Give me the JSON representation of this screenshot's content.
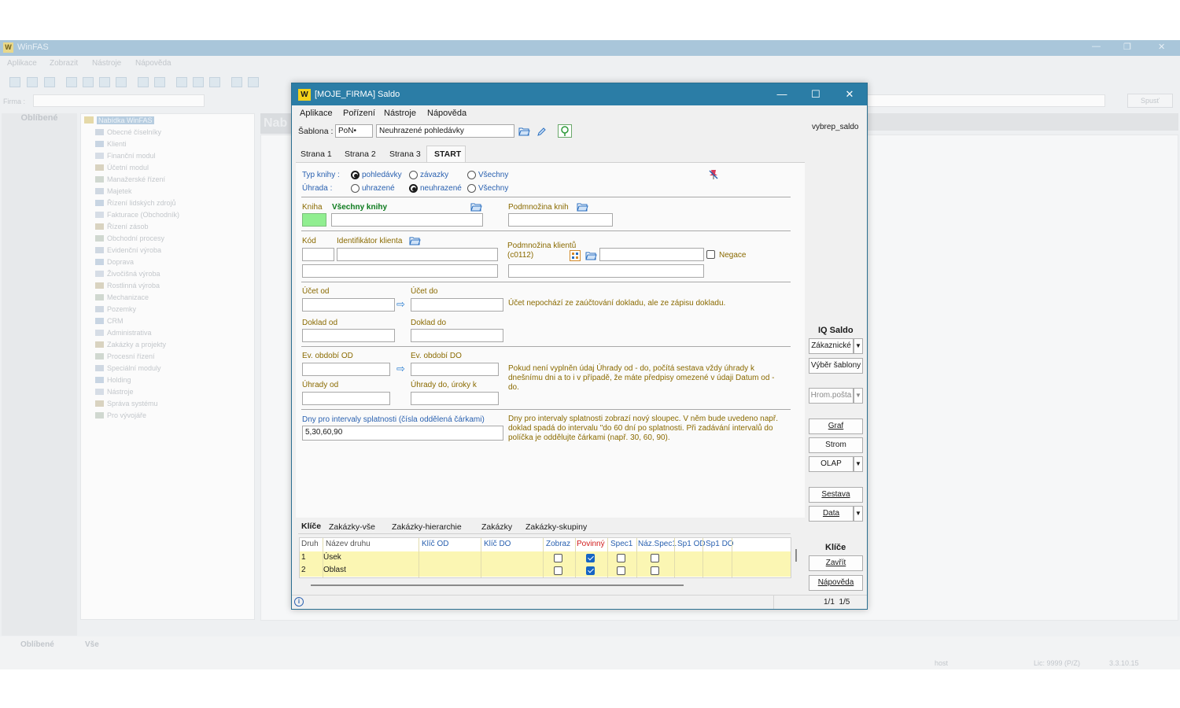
{
  "background": {
    "app_title": "WinFAS",
    "menu": [
      "Aplikace",
      "Zobrazit",
      "Nástroje",
      "Nápověda"
    ],
    "firma_label": "Firma :",
    "spust_label": "Spusť",
    "favorites_title": "Oblíbené",
    "nab_label": "Nab",
    "tree_root": "Nabídka WinFAS",
    "tree_items": [
      "Obecné číselníky",
      "Klienti",
      "Finanční modul",
      "Účetní modul",
      "Manažerské řízení",
      "Majetek",
      "Řízení lidských zdrojů",
      "Fakturace (Obchodník)",
      "Řízení zásob",
      "Obchodní procesy",
      "Evidenční výroba",
      "Doprava",
      "Živočišná výroba",
      "Rostlinná výroba",
      "Mechanizace",
      "Pozemky",
      "CRM",
      "Administrativa",
      "Zakázky a projekty",
      "Procesní řízení",
      "Speciální moduly",
      "Holding",
      "Nástroje",
      "Správa systému",
      "Pro vývojáře"
    ],
    "bottom_tabs": [
      "Oblíbené",
      "Vše"
    ],
    "status_user": "host",
    "status_lic": "Lic: 9999 (P/Z)",
    "status_version": "3.3.10.15"
  },
  "dialog": {
    "title": "[MOJE_FIRMA] Saldo",
    "menu": [
      "Aplikace",
      "Pořízení",
      "Nástroje",
      "Nápověda"
    ],
    "sablona_label": "Šablona :",
    "sablona_code": "PoN•",
    "sablona_name": "Neuhrazené pohledávky",
    "report_id": "vybrep_saldo",
    "tabs": [
      "Strana 1",
      "Strana 2",
      "Strana 3",
      "START"
    ],
    "active_tab": "START",
    "typ_knihy_label": "Typ knihy :",
    "typ_knihy_options": [
      "pohledávky",
      "závazky",
      "Všechny"
    ],
    "typ_knihy_selected": "pohledávky",
    "uhrada_label": "Úhrada :",
    "uhrada_options": [
      "uhrazené",
      "neuhrazené",
      "Všechny"
    ],
    "uhrada_selected": "neuhrazené",
    "kniha_label": "Kniha",
    "kniha_name": "Všechny knihy",
    "podmnozina_knih_label": "Podmnožina knih",
    "kod_label": "Kód",
    "identifikator_label": "Identifikátor klienta",
    "podmnozina_klientu_label": "Podmnožina klientů",
    "podmnozina_klientu_code": "(c0112)",
    "negace_label": "Negace",
    "ucet_od_label": "Účet od",
    "ucet_do_label": "Účet do",
    "ucet_note": "Účet nepochází ze zaúčtování dokladu, ale ze zápisu dokladu.",
    "doklad_od_label": "Doklad od",
    "doklad_do_label": "Doklad do",
    "ev_od_label": "Ev. období OD",
    "ev_do_label": "Ev. období DO",
    "uhrady_od_label": "Úhrady od",
    "uhrady_do_label": "Úhrady do, úroky k",
    "uhrady_note": "Pokud není vyplněn údaj Úhrady od - do, počítá sestava vždy úhrady k dnešnímu dni a to i v případě, že máte předpisy omezené v údaji Datum od - do.",
    "dny_label": "Dny pro intervaly splatnosti (čísla oddělená čárkami)",
    "dny_value": "5,30,60,90",
    "dny_note": "Dny pro intervaly splatnosti zobrazí nový sloupec. V něm bude uvedeno např. doklad spadá do intervalu \"do 60 dní po splatnosti. Při zadávání intervalů do políčka je oddělujte čárkami (např. 30, 60, 90).",
    "grid_tabs": [
      "Klíče",
      "Zakázky-vše",
      "Zakázky-hierarchie",
      "Zakázky",
      "Zakázky-skupiny"
    ],
    "grid_active_tab": "Klíče",
    "grid_columns": [
      "Druh",
      "Název druhu",
      "Klíč OD",
      "Klíč DO",
      "Zobraz",
      "Povinný",
      "Spec1",
      "Náz.Spec1",
      "Sp1 OD",
      "Sp1 DO"
    ],
    "grid_rows": [
      {
        "druh": "1",
        "nazev": "Úsek",
        "zobraz": false,
        "povinny": true,
        "spec1": false,
        "naz_spec1": false
      },
      {
        "druh": "2",
        "nazev": "Oblast",
        "zobraz": false,
        "povinny": true,
        "spec1": false,
        "naz_spec1": false
      }
    ],
    "right": {
      "iq_title": "IQ Saldo",
      "zakaznicke": "Zákaznické",
      "vyber_sablony": "Výběr šablony",
      "hrom_posta": "Hrom.pošta",
      "graf": "Graf",
      "strom": "Strom",
      "olap": "OLAP",
      "sestava": "Sestava",
      "data": "Data",
      "klice_title": "Klíče",
      "zavrit": "Zavřít",
      "napoveda": "Nápověda"
    },
    "status_pages": "1/1  1/5"
  },
  "colors": {
    "title_bar": "#2b7da6",
    "label_orange": "#8a6a00",
    "label_green": "#0b7a1c",
    "label_blue": "#2a61b0",
    "grid_row": "#fbf6b3",
    "kniha_field": "#90ee90"
  }
}
